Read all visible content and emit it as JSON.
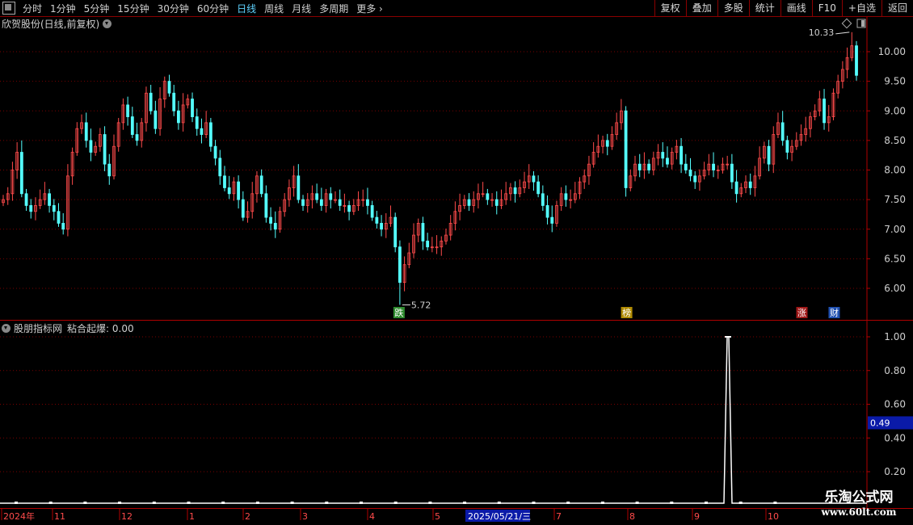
{
  "toolbar": {
    "periods": [
      "分时",
      "1分钟",
      "5分钟",
      "15分钟",
      "30分钟",
      "60分钟",
      "日线",
      "周线",
      "月线",
      "多周期",
      "更多"
    ],
    "active_period": "日线",
    "buttons": [
      "复权",
      "叠加",
      "多股",
      "统计",
      "画线",
      "F10",
      "+自选",
      "返回"
    ]
  },
  "main_panel": {
    "title": "欣贺股份(日线,前复权)",
    "max_label": "10.33",
    "min_label": "5.72",
    "markers": [
      {
        "text": "跌",
        "color": "#2e8b2e"
      },
      {
        "text": "榜",
        "color": "#b08a00"
      },
      {
        "text": "涨",
        "color": "#a01818"
      },
      {
        "text": "财",
        "color": "#2050b0"
      }
    ]
  },
  "indicator_panel": {
    "title": "股朋指标网",
    "value_label": "粘合起爆: 0.00",
    "current_value": "0.49"
  },
  "axis": {
    "date_labels": [
      "2024年",
      "11",
      "12",
      "1",
      "2",
      "3",
      "4",
      "5",
      "7",
      "8",
      "9",
      "10"
    ],
    "cursor_date": "2025/05/21/三"
  },
  "watermark": {
    "line1": "乐淘公式网",
    "line2": "www.60lt.com"
  },
  "colors": {
    "up": "#ff4b4b",
    "down": "#54ffff",
    "grid": "#7a0000",
    "axis_text": "#d0d0d0"
  },
  "chart_data": [
    {
      "type": "candlestick",
      "title": "欣贺股份(日线,前复权)",
      "ylim": [
        5.5,
        10.5
      ],
      "yticks": [
        6.0,
        6.5,
        7.0,
        7.5,
        8.0,
        8.5,
        9.0,
        9.5,
        10.0
      ],
      "close_approx": [
        7.5,
        7.6,
        8.0,
        8.3,
        7.6,
        7.4,
        7.3,
        7.4,
        7.5,
        7.6,
        7.4,
        7.3,
        7.1,
        7.0,
        7.9,
        8.3,
        8.7,
        8.8,
        8.5,
        8.3,
        8.4,
        8.6,
        8.1,
        7.9,
        8.4,
        8.8,
        9.1,
        8.9,
        8.6,
        8.5,
        8.8,
        9.3,
        9.0,
        8.7,
        9.2,
        9.5,
        9.3,
        9.0,
        8.8,
        9.1,
        9.2,
        8.9,
        8.7,
        8.6,
        8.8,
        8.4,
        8.2,
        7.9,
        7.7,
        7.6,
        7.8,
        7.5,
        7.2,
        7.3,
        7.6,
        7.9,
        7.6,
        7.2,
        7.1,
        7.0,
        7.3,
        7.5,
        7.7,
        7.9,
        7.5,
        7.4,
        7.5,
        7.6,
        7.5,
        7.4,
        7.6,
        7.5,
        7.5,
        7.4,
        7.4,
        7.3,
        7.4,
        7.5,
        7.5,
        7.4,
        7.2,
        7.1,
        7.0,
        7.1,
        7.2,
        6.7,
        6.1,
        6.4,
        6.6,
        6.9,
        7.1,
        6.8,
        6.7,
        6.7,
        6.7,
        6.8,
        6.9,
        7.1,
        7.3,
        7.4,
        7.5,
        7.4,
        7.5,
        7.6,
        7.6,
        7.5,
        7.5,
        7.4,
        7.5,
        7.6,
        7.7,
        7.6,
        7.7,
        7.8,
        7.9,
        7.8,
        7.6,
        7.4,
        7.2,
        7.1,
        7.4,
        7.6,
        7.5,
        7.5,
        7.6,
        7.8,
        7.9,
        8.1,
        8.3,
        8.4,
        8.5,
        8.4,
        8.6,
        8.8,
        9.0,
        7.7,
        7.9,
        8.1,
        8.0,
        8.1,
        8.0,
        8.2,
        8.3,
        8.2,
        8.1,
        8.3,
        8.4,
        8.1,
        8.0,
        7.9,
        7.8,
        7.9,
        8.0,
        8.1,
        8.0,
        8.0,
        8.1,
        8.1,
        7.8,
        7.6,
        7.7,
        7.8,
        7.7,
        7.9,
        8.2,
        8.4,
        8.1,
        8.6,
        8.8,
        8.5,
        8.3,
        8.4,
        8.5,
        8.6,
        8.7,
        8.9,
        9.0,
        9.2,
        8.8,
        8.9,
        9.3,
        9.5,
        9.7,
        9.9,
        10.1,
        9.6
      ]
    },
    {
      "type": "line",
      "title": "股朋指标网",
      "ylim": [
        0.1,
        1.05
      ],
      "yticks": [
        0.2,
        0.4,
        0.6,
        0.8,
        1.0
      ],
      "series": [
        {
          "name": "粘合起爆",
          "spike_index": 176,
          "spike_value": 1.0,
          "baseline": 0.0
        }
      ]
    }
  ]
}
